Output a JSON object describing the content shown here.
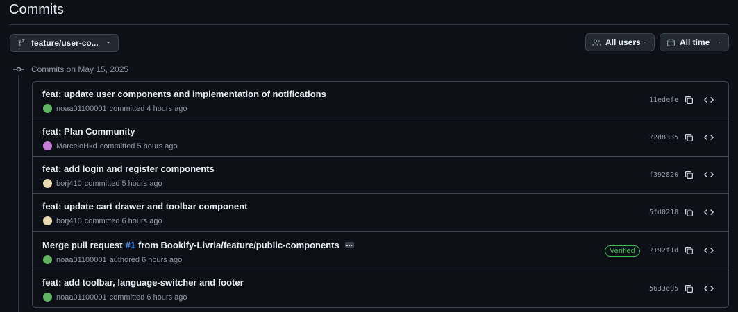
{
  "page": {
    "title": "Commits"
  },
  "filters": {
    "branch_label": "feature/user-co...",
    "users_label": "All users",
    "time_label": "All time"
  },
  "group": {
    "label": "Commits on May 15, 2025"
  },
  "commits": [
    {
      "message": "feat: update user components and implementation of notifications",
      "author": "noaa01100001",
      "action": "committed 4 hours ago",
      "sha": "11edefe",
      "avatar_color": "#5fb35f"
    },
    {
      "message": "feat: Plan Community",
      "author": "MarceloHkd",
      "action": "committed 5 hours ago",
      "sha": "72d8335",
      "avatar_color": "#c77dd8"
    },
    {
      "message": "feat: add login and register components",
      "author": "borj410",
      "action": "committed 5 hours ago",
      "sha": "f392820",
      "avatar_color": "#e8d9b0"
    },
    {
      "message": "feat: update cart drawer and toolbar component",
      "author": "borj410",
      "action": "committed 6 hours ago",
      "sha": "5fd0218",
      "avatar_color": "#e8d9b0"
    },
    {
      "message_prefix": "Merge pull request",
      "pr_link": "#1",
      "message_suffix": "from Bookify-Livria/feature/public-components",
      "author": "noaa01100001",
      "action": "authored 6 hours ago",
      "sha": "7192f1d",
      "badge": "Verified",
      "avatar_color": "#5fb35f"
    },
    {
      "message": "feat: add toolbar, language-switcher and footer",
      "author": "noaa01100001",
      "action": "committed 6 hours ago",
      "sha": "5633e05",
      "avatar_color": "#5fb35f"
    }
  ]
}
